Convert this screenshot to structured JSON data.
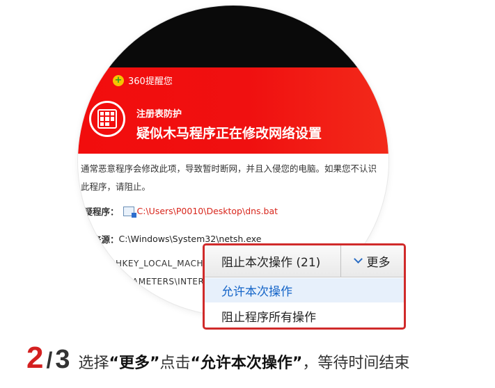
{
  "dialog": {
    "brand": "360提醒您",
    "alert_sub": "注册表防护",
    "alert_title": "疑似木马程序正在修改网络设置",
    "description_line1": "通常恶意程序会修改此项，导致暂时断网，并且入侵您的电脑。如果您不认识",
    "description_line2": "此程序，请阻止。",
    "suspicious_label": "可疑程序：",
    "suspicious_path": "C:\\Users\\P0010\\Desktop\\dns.bat",
    "source_label": "程序来源：",
    "source_path": "C:\\Windows\\System32\\netsh.exe",
    "registry_line1": "HKEY_LOCAL_MACHINE",
    "registry_line2": "PARAMETERS\\INTER"
  },
  "actions": {
    "block_once": "阻止本次操作 (21)",
    "more": "更多",
    "allow_once": "允许本次操作",
    "block_all": "阻止程序所有操作"
  },
  "caption": {
    "step": "2",
    "slash": "/",
    "total": "3",
    "text_prefix": "选择",
    "quoted_more": "“更多”",
    "text_mid": "点击",
    "quoted_allow": "“允许本次操作”",
    "text_suffix": "，等待时间结束"
  },
  "colors": {
    "alert_red": "#f20d0d",
    "highlight_border": "#d02a2a",
    "link_blue": "#1565c8",
    "path_red": "#d8261c"
  }
}
